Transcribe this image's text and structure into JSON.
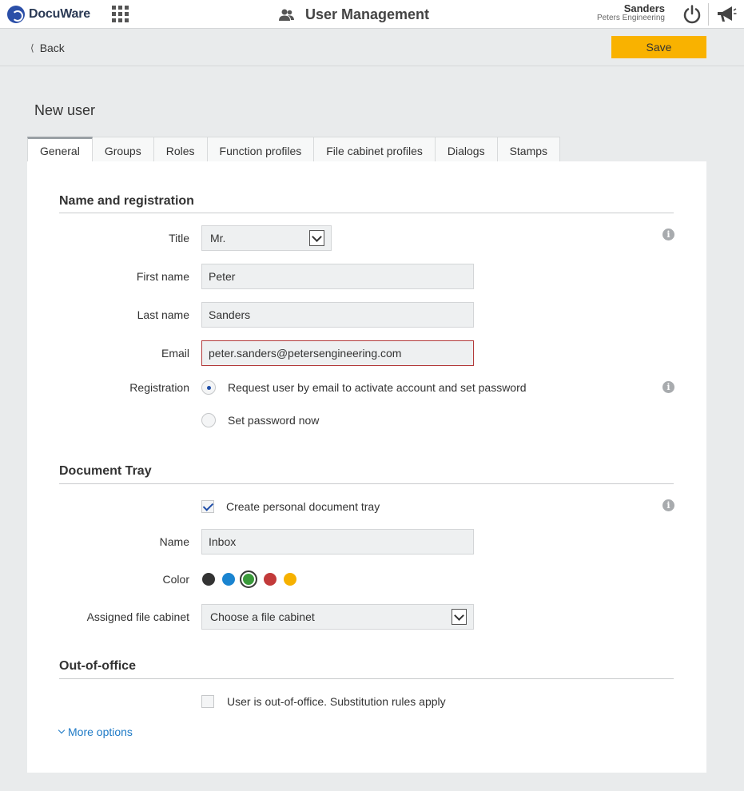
{
  "header": {
    "logo_text": "DocuWare",
    "app_title": "User Management",
    "user_name": "Sanders",
    "user_company": "Peters Engineering"
  },
  "actionbar": {
    "back_label": "Back",
    "save_label": "Save"
  },
  "page": {
    "title": "New user"
  },
  "tabs": [
    {
      "label": "General",
      "active": true
    },
    {
      "label": "Groups",
      "active": false
    },
    {
      "label": "Roles",
      "active": false
    },
    {
      "label": "Function profiles",
      "active": false
    },
    {
      "label": "File cabinet profiles",
      "active": false
    },
    {
      "label": "Dialogs",
      "active": false
    },
    {
      "label": "Stamps",
      "active": false
    }
  ],
  "name_registration": {
    "section_title": "Name and registration",
    "title_label": "Title",
    "title_value": "Mr.",
    "first_name_label": "First name",
    "first_name_value": "Peter",
    "last_name_label": "Last name",
    "last_name_value": "Sanders",
    "email_label": "Email",
    "email_value": "peter.sanders@petersengineering.com",
    "registration_label": "Registration",
    "registration_options": [
      {
        "label": "Request user by email to activate account and set password",
        "selected": true
      },
      {
        "label": "Set password now",
        "selected": false
      }
    ]
  },
  "document_tray": {
    "section_title": "Document Tray",
    "create_tray_label": "Create personal document tray",
    "create_tray_checked": true,
    "name_label": "Name",
    "name_value": "Inbox",
    "color_label": "Color",
    "colors": [
      "#333333",
      "#1a84d0",
      "#3a9a3a",
      "#c23a3a",
      "#f6b100"
    ],
    "selected_color": "#3a9a3a",
    "file_cabinet_label": "Assigned file cabinet",
    "file_cabinet_value": "Choose a file cabinet"
  },
  "out_of_office": {
    "section_title": "Out-of-office",
    "checkbox_label": "User is out-of-office. Substitution rules apply",
    "checked": false,
    "more_options_label": "More options"
  }
}
